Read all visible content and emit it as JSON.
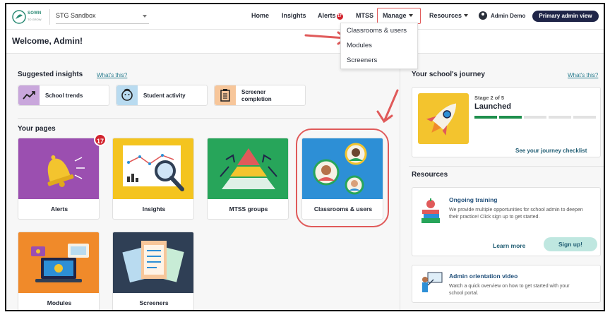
{
  "brand": {
    "logo_line1": "SOWN",
    "logo_line2": "TO GROW"
  },
  "school_selector": {
    "value": "STG Sandbox"
  },
  "nav": {
    "home": "Home",
    "insights": "Insights",
    "alerts": "Alerts",
    "alerts_badge": "17",
    "mtss": "MTSS",
    "manage": "Manage",
    "resources": "Resources",
    "user_name": "Admin Demo",
    "primary_btn": "Primary admin view"
  },
  "manage_menu": {
    "items": [
      "Classrooms & users",
      "Modules",
      "Screeners"
    ]
  },
  "welcome": "Welcome, Admin!",
  "suggested": {
    "title": "Suggested insights",
    "whats_this": "What's this?",
    "cards": [
      {
        "label": "School trends",
        "icon": "trend-chart-icon",
        "color": "#c9a7dc"
      },
      {
        "label": "Student activity",
        "icon": "face-icon",
        "color": "#b9dbf0"
      },
      {
        "label_line1": "Screener",
        "label_line2": "completion",
        "icon": "clipboard-icon",
        "color": "#f7c69a"
      }
    ]
  },
  "your_pages": {
    "title": "Your pages",
    "alerts_count": "17",
    "cards": [
      {
        "label": "Alerts",
        "color": "#9b4fb0"
      },
      {
        "label": "Insights",
        "color": "#f4c41f"
      },
      {
        "label": "MTSS groups",
        "color": "#27a55a"
      },
      {
        "label": "Classrooms & users",
        "color": "#2d8fd6"
      },
      {
        "label": "Modules",
        "color": "#f08a2a"
      },
      {
        "label": "Screeners",
        "color": "#2f3f55"
      }
    ]
  },
  "journey": {
    "title": "Your school's journey",
    "whats_this": "What's this?",
    "stage": "Stage 2 of 5",
    "stage_name": "Launched",
    "progress": {
      "completed": 2,
      "total": 5
    },
    "checklist_link": "See your journey checklist"
  },
  "resources": {
    "title": "Resources",
    "training": {
      "title": "Ongoing training",
      "desc": "We provide multiple opportunities for school admin to deepen their practice! Click sign up to get started.",
      "learn_more": "Learn more",
      "signup": "Sign up!"
    },
    "orientation": {
      "title": "Admin orientation video",
      "desc": "Watch a quick overview on how to get started with your school portal."
    }
  }
}
